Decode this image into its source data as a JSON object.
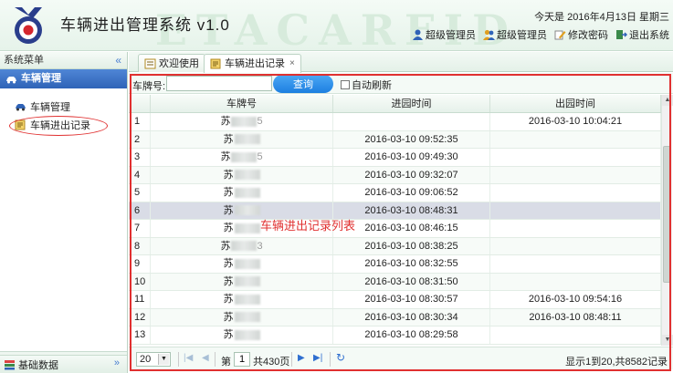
{
  "header": {
    "title": "车辆进出管理系统 v1.0",
    "date_text": "今天是 2016年4月13日 星期三",
    "watermark": "ETACARFID",
    "links": [
      {
        "label": "超级管理员",
        "icon": "user-icon"
      },
      {
        "label": "超级管理员",
        "icon": "switch-user-icon"
      },
      {
        "label": "修改密码",
        "icon": "edit-password-icon"
      },
      {
        "label": "退出系统",
        "icon": "logout-icon"
      }
    ]
  },
  "sidebar": {
    "title": "系统菜单",
    "group": "车辆管理",
    "items": [
      {
        "label": "车辆管理",
        "icon": "car-icon"
      },
      {
        "label": "车辆进出记录",
        "icon": "record-icon"
      }
    ],
    "footer": "基础数据"
  },
  "tabs": [
    {
      "label": "欢迎使用",
      "closable": false
    },
    {
      "label": "车辆进出记录",
      "closable": true,
      "close": "×"
    }
  ],
  "toolbar": {
    "plate_label": "车牌号:",
    "plate_value": "",
    "search_button": "查询",
    "auto_refresh_label": "自动刷新"
  },
  "grid": {
    "columns": [
      "",
      "车牌号",
      "进园时间",
      "出园时间"
    ],
    "overlay_label": "车辆进出记录列表",
    "rows": [
      {
        "num": "1",
        "plate_prefix": "苏",
        "plate_tail": "5",
        "in_time": "",
        "out_time": "2016-03-10 10:04:21"
      },
      {
        "num": "2",
        "plate_prefix": "苏",
        "plate_tail": "",
        "in_time": "2016-03-10 09:52:35",
        "out_time": ""
      },
      {
        "num": "3",
        "plate_prefix": "苏",
        "plate_tail": "5",
        "in_time": "2016-03-10 09:49:30",
        "out_time": ""
      },
      {
        "num": "4",
        "plate_prefix": "苏",
        "plate_tail": "",
        "in_time": "2016-03-10 09:32:07",
        "out_time": ""
      },
      {
        "num": "5",
        "plate_prefix": "苏",
        "plate_tail": "",
        "in_time": "2016-03-10 09:06:52",
        "out_time": ""
      },
      {
        "num": "6",
        "plate_prefix": "苏",
        "plate_tail": "",
        "in_time": "2016-03-10 08:48:31",
        "out_time": ""
      },
      {
        "num": "7",
        "plate_prefix": "苏",
        "plate_tail": "",
        "in_time": "2016-03-10 08:46:15",
        "out_time": ""
      },
      {
        "num": "8",
        "plate_prefix": "苏",
        "plate_tail": "3",
        "in_time": "2016-03-10 08:38:25",
        "out_time": ""
      },
      {
        "num": "9",
        "plate_prefix": "苏",
        "plate_tail": "",
        "in_time": "2016-03-10 08:32:55",
        "out_time": ""
      },
      {
        "num": "10",
        "plate_prefix": "苏",
        "plate_tail": "",
        "in_time": "2016-03-10 08:31:50",
        "out_time": ""
      },
      {
        "num": "11",
        "plate_prefix": "苏",
        "plate_tail": "",
        "in_time": "2016-03-10 08:30:57",
        "out_time": "2016-03-10 09:54:16"
      },
      {
        "num": "12",
        "plate_prefix": "苏",
        "plate_tail": "",
        "in_time": "2016-03-10 08:30:34",
        "out_time": "2016-03-10 08:48:11"
      },
      {
        "num": "13",
        "plate_prefix": "苏",
        "plate_tail": "",
        "in_time": "2016-03-10 08:29:58",
        "out_time": ""
      }
    ],
    "selected_row": 6
  },
  "pager": {
    "page_size": "20",
    "page_label": "第",
    "page_value": "1",
    "total_pages": "共430页",
    "info": "显示1到20,共8582记录"
  },
  "colors": {
    "accent_blue": "#2f63b7",
    "annotation_red": "#e03030",
    "button_blue": "#1d7fe0"
  }
}
